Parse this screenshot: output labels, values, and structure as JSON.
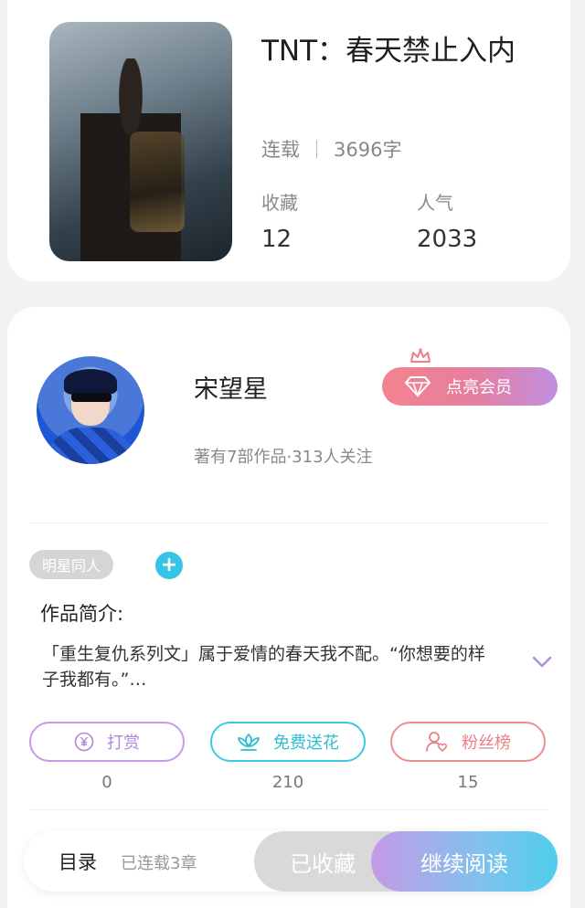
{
  "book": {
    "title": "TNT：春天禁止入内",
    "status": "连载",
    "word_count": "3696字",
    "favorites_label": "收藏",
    "favorites_value": "12",
    "popularity_label": "人气",
    "popularity_value": "2033"
  },
  "author": {
    "name": "宋望星",
    "summary": "著有7部作品·313人关注",
    "vip_label": "点亮会员"
  },
  "tags": [
    "明星同人"
  ],
  "intro": {
    "title": "作品简介:",
    "text": "「重生复仇系列文」属于爱情的春天我不配。“你想要的样子我都有。”…"
  },
  "actions": [
    {
      "label": "打赏",
      "count": "0",
      "icon": "yen-coin-icon"
    },
    {
      "label": "免费送花",
      "count": "210",
      "icon": "flower-icon"
    },
    {
      "label": "粉丝榜",
      "count": "15",
      "icon": "fan-user-icon"
    }
  ],
  "bottom_bar": {
    "toc_label": "目录",
    "chapters_label": "已连载3章",
    "collected_label": "已收藏",
    "continue_label": "继续阅读"
  },
  "colors": {
    "accent_cyan": "#36c3e6",
    "vip_gradient_start": "#f3838f",
    "vip_gradient_end": "#c08fe0",
    "reward_purple": "#c79ae6",
    "flower_cyan": "#3cc9dd",
    "fans_pink": "#ef8c93"
  }
}
